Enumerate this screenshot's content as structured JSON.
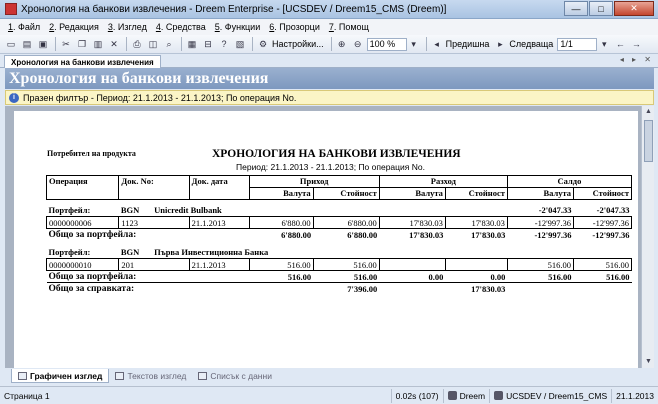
{
  "window": {
    "title": "Хронология на банкови извлечения - Dreem Enterprise - [UCSDEV / Dreem15_CMS (Dreem)]",
    "buttons": {
      "minimize": "—",
      "maximize": "□",
      "close": "✕"
    }
  },
  "menu": [
    {
      "key": "1",
      "label": ". Файл"
    },
    {
      "key": "2",
      "label": ". Редакция"
    },
    {
      "key": "3",
      "label": ". Изглед"
    },
    {
      "key": "4",
      "label": ". Средства"
    },
    {
      "key": "5",
      "label": ". Функции"
    },
    {
      "key": "6",
      "label": ". Прозорци"
    },
    {
      "key": "7",
      "label": ". Помощ"
    }
  ],
  "toolbar": {
    "settings_label": "Настройки...",
    "zoom_value": "100 %",
    "prev_label": "Предишна",
    "next_label": "Следваща",
    "page_value": "1/1"
  },
  "tab": {
    "label": "Хронология на банкови извлечения",
    "controls": "◂ ▸ ✕"
  },
  "header": {
    "title": "Хронология на банкови извлечения"
  },
  "filter": {
    "icon": "info-icon",
    "text": "Празен филтър - Период: 21.1.2013 - 21.1.2013; По операция No."
  },
  "report": {
    "consumer_label": "Потребител на продукта",
    "title": "ХРОНОЛОГИЯ НА БАНКОВИ ИЗВЛЕЧЕНИЯ",
    "period": "Период: 21.1.2013 - 21.1.2013; По операция No.",
    "columns": {
      "operation": "Операция",
      "doc_no": "Док. No:",
      "doc_date": "Док. дата",
      "income": "Приход",
      "expense": "Разход",
      "balance": "Салдо",
      "currency": "Валута",
      "value": "Стойност"
    },
    "portfolios": [
      {
        "label": "Портфейл:",
        "currency": "BGN",
        "bank": "Unicredit Bulbank",
        "opening_currency": "-2'047.33",
        "opening_value": "-2'047.33",
        "rows": [
          {
            "operation": "0000000006",
            "doc_no": "1123",
            "doc_date": "21.1.2013",
            "inc_cur": "6'880.00",
            "inc_val": "6'880.00",
            "exp_cur": "17'830.03",
            "exp_val": "17'830.03",
            "bal_cur": "-12'997.36",
            "bal_val": "-12'997.36"
          }
        ],
        "total_label": "Общо за портфейла:",
        "total": {
          "inc_cur": "6'880.00",
          "inc_val": "6'880.00",
          "exp_cur": "17'830.03",
          "exp_val": "17'830.03",
          "bal_cur": "-12'997.36",
          "bal_val": "-12'997.36"
        }
      },
      {
        "label": "Портфейл:",
        "currency": "BGN",
        "bank": "Първа Инвестиционна Банка",
        "rows": [
          {
            "operation": "0000000010",
            "doc_no": "201",
            "doc_date": "21.1.2013",
            "inc_cur": "516.00",
            "inc_val": "516.00",
            "exp_cur": "",
            "exp_val": "",
            "bal_cur": "516.00",
            "bal_val": "516.00"
          }
        ],
        "total_label": "Общо за портфейла:",
        "total": {
          "inc_cur": "516.00",
          "inc_val": "516.00",
          "exp_cur": "0.00",
          "exp_val": "0.00",
          "bal_cur": "516.00",
          "bal_val": "516.00"
        }
      }
    ],
    "grand_total_label": "Общо за справката:",
    "grand_total": {
      "inc_val": "7'396.00",
      "exp_val": "17'830.03"
    }
  },
  "bottom_tabs": [
    {
      "label": "Графичен изглед"
    },
    {
      "label": "Текстов изглед"
    },
    {
      "label": "Списък с данни"
    }
  ],
  "status": {
    "page": "Страница 1",
    "time": "0.02s (107)",
    "user": "Dreem",
    "db": "UCSDEV / Dreem15_CMS",
    "date": "21.1.2013"
  }
}
